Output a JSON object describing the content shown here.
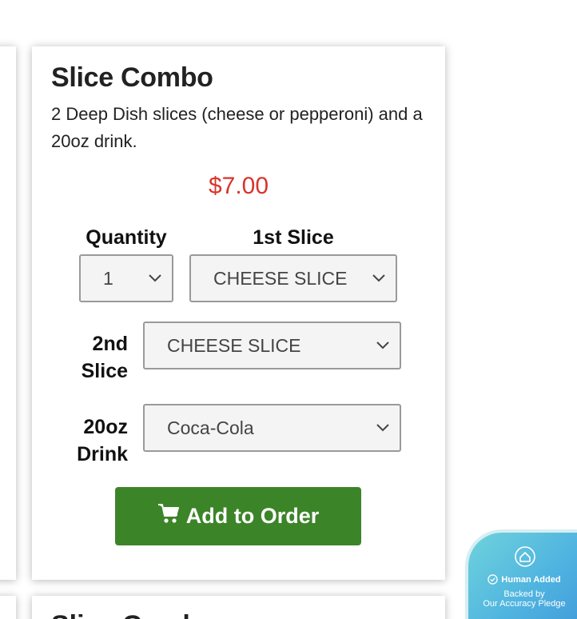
{
  "product": {
    "title": "Slice Combo",
    "description": "2 Deep Dish slices (cheese or pepperoni) and a 20oz drink.",
    "price": "$7.00"
  },
  "options": {
    "quantity": {
      "label": "Quantity",
      "value": "1"
    },
    "first_slice": {
      "label": "1st Slice",
      "value": "CHEESE SLICE"
    },
    "second_slice": {
      "label_line1": "2nd",
      "label_line2": "Slice",
      "value": "CHEESE SLICE"
    },
    "drink": {
      "label_line1": "20oz",
      "label_line2": "Drink",
      "value": "Coca-Cola"
    }
  },
  "actions": {
    "add_to_order": "Add to Order"
  },
  "next_card": {
    "title_partial": "Slice Comb"
  },
  "badge": {
    "human_added": "Human Added",
    "backed_line1": "Backed by",
    "backed_line2": "Our Accuracy Pledge"
  },
  "colors": {
    "price": "#d9342b",
    "button": "#3c8428",
    "badge_gradient_start": "#6fd3dc",
    "badge_gradient_end": "#3f97d8"
  },
  "icons": {
    "cart": "cart-icon",
    "chevron": "chevron-down-icon",
    "home": "home-icon",
    "check": "check-circle-icon"
  }
}
